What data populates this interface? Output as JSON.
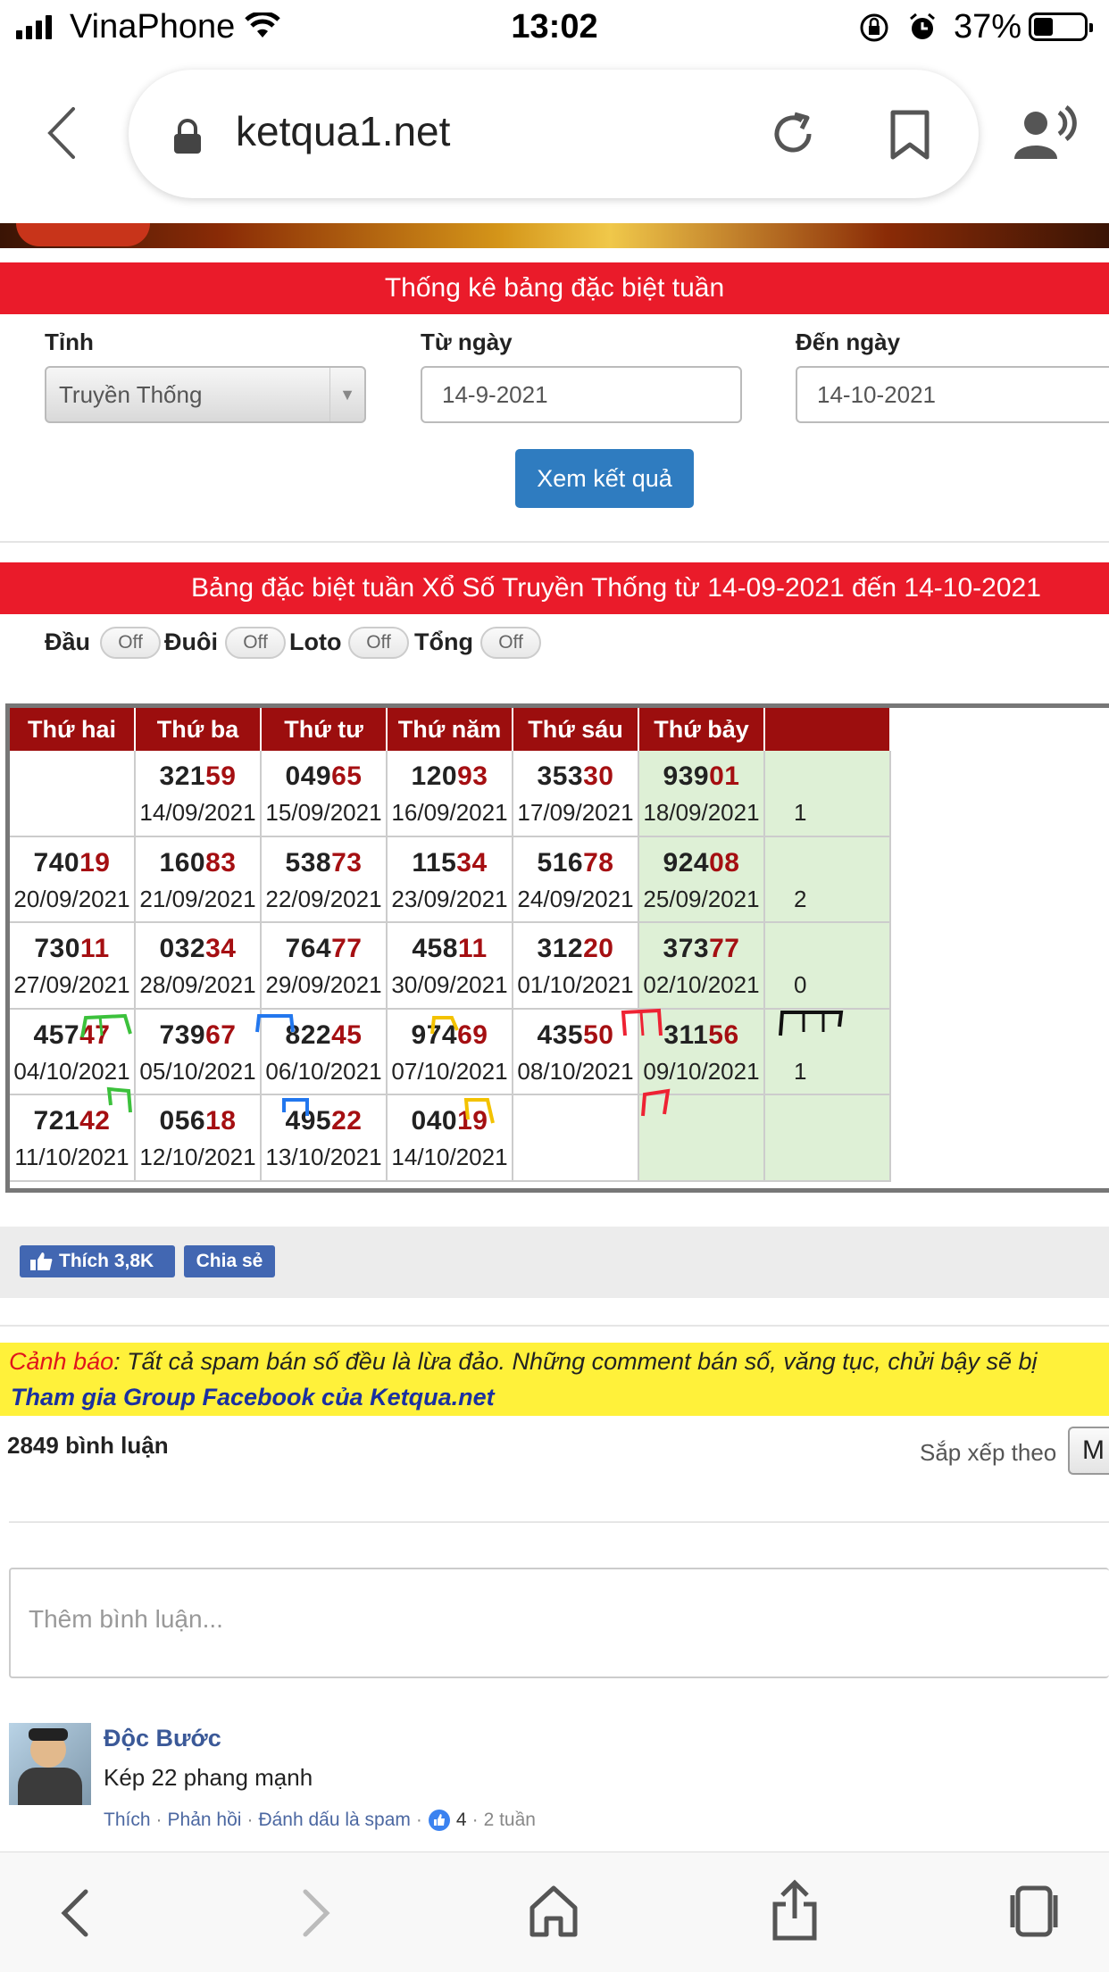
{
  "status_bar": {
    "carrier": "VinaPhone",
    "time": "13:02",
    "battery_percent": "37%",
    "icons": [
      "signal-icon",
      "wifi-icon",
      "rotation-lock-icon",
      "alarm-icon",
      "battery-icon"
    ]
  },
  "browser": {
    "url": "ketqua1.net",
    "icons": [
      "back-icon",
      "lock-icon",
      "reload-icon",
      "bookmark-icon",
      "reader-voice-icon"
    ]
  },
  "filter": {
    "title": "Thống kê bảng đặc biệt tuần",
    "province_label": "Tỉnh",
    "province_value": "Truyền Thống",
    "from_label": "Từ ngày",
    "from_value": "14-9-2021",
    "to_label": "Đến ngày",
    "to_value": "14-10-2021",
    "submit_label": "Xem kết quả"
  },
  "results": {
    "title": "Bảng đặc biệt tuần Xổ Số Truyền Thống từ 14-09-2021 đến 14-10-2021",
    "toggles": [
      {
        "label": "Đầu",
        "state": "Off"
      },
      {
        "label": "Đuôi",
        "state": "Off"
      },
      {
        "label": "Loto",
        "state": "Off"
      },
      {
        "label": "Tổng",
        "state": "Off"
      }
    ],
    "headers": [
      "Thứ hai",
      "Thứ ba",
      "Thứ tư",
      "Thứ năm",
      "Thứ sáu",
      "Thứ bảy"
    ],
    "rows": [
      [
        null,
        {
          "pre": "321",
          "tail": "59",
          "date": "14/09/2021"
        },
        {
          "pre": "049",
          "tail": "65",
          "date": "15/09/2021"
        },
        {
          "pre": "120",
          "tail": "93",
          "date": "16/09/2021"
        },
        {
          "pre": "353",
          "tail": "30",
          "date": "17/09/2021"
        },
        {
          "pre": "939",
          "tail": "01",
          "date": "18/09/2021"
        },
        {
          "pre": "",
          "tail": "",
          "date": "1"
        }
      ],
      [
        {
          "pre": "740",
          "tail": "19",
          "date": "20/09/2021"
        },
        {
          "pre": "160",
          "tail": "83",
          "date": "21/09/2021"
        },
        {
          "pre": "538",
          "tail": "73",
          "date": "22/09/2021"
        },
        {
          "pre": "115",
          "tail": "34",
          "date": "23/09/2021"
        },
        {
          "pre": "516",
          "tail": "78",
          "date": "24/09/2021"
        },
        {
          "pre": "924",
          "tail": "08",
          "date": "25/09/2021"
        },
        {
          "pre": "",
          "tail": "",
          "date": "2"
        }
      ],
      [
        {
          "pre": "730",
          "tail": "11",
          "date": "27/09/2021"
        },
        {
          "pre": "032",
          "tail": "34",
          "date": "28/09/2021"
        },
        {
          "pre": "764",
          "tail": "77",
          "date": "29/09/2021"
        },
        {
          "pre": "458",
          "tail": "11",
          "date": "30/09/2021"
        },
        {
          "pre": "312",
          "tail": "20",
          "date": "01/10/2021"
        },
        {
          "pre": "373",
          "tail": "77",
          "date": "02/10/2021"
        },
        {
          "pre": "",
          "tail": "",
          "date": "0"
        }
      ],
      [
        {
          "pre": "457",
          "tail": "47",
          "date": "04/10/2021"
        },
        {
          "pre": "739",
          "tail": "67",
          "date": "05/10/2021"
        },
        {
          "pre": "822",
          "tail": "45",
          "date": "06/10/2021"
        },
        {
          "pre": "974",
          "tail": "69",
          "date": "07/10/2021"
        },
        {
          "pre": "435",
          "tail": "50",
          "date": "08/10/2021"
        },
        {
          "pre": "311",
          "tail": "56",
          "date": "09/10/2021"
        },
        {
          "pre": "",
          "tail": "",
          "date": "1"
        }
      ],
      [
        {
          "pre": "721",
          "tail": "42",
          "date": "11/10/2021"
        },
        {
          "pre": "056",
          "tail": "18",
          "date": "12/10/2021"
        },
        {
          "pre": "495",
          "tail": "22",
          "date": "13/10/2021"
        },
        {
          "pre": "040",
          "tail": "19",
          "date": "14/10/2021"
        },
        null,
        null,
        null
      ]
    ]
  },
  "social": {
    "like_label": "Thích 3,8K",
    "share_label": "Chia sẻ"
  },
  "warning": {
    "prefix": "Cảnh báo",
    "text": ": Tất cả spam bán số đều là lừa đảo. Những comment bán số, văng tục, chửi bậy sẽ bị",
    "group_link": "Tham gia Group Facebook của Ketqua.net"
  },
  "comments": {
    "count_label": "2849 bình luận",
    "sort_label": "Sắp xếp theo",
    "sort_value": "M",
    "input_placeholder": "Thêm bình luận...",
    "items": [
      {
        "author": "Độc Bước",
        "text": "Kép 22 phang mạnh",
        "like": "Thích",
        "reply": "Phản hồi",
        "spam": "Đánh dấu là spam",
        "likes": "4",
        "time": "2 tuần"
      }
    ]
  },
  "colors": {
    "red_bar": "#ea1b2a",
    "header_bg": "#9c0e0e",
    "highlight": "#a50f12",
    "saturday_bg": "#def0d6",
    "button": "#2f7cc0",
    "warning_bg": "#fff13a"
  }
}
